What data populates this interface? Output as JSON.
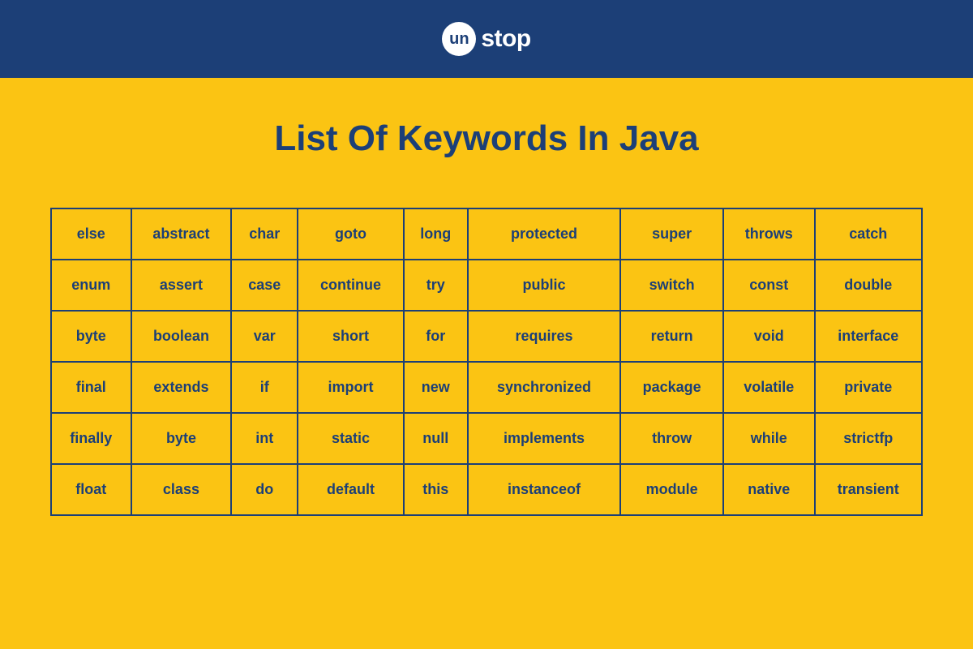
{
  "header": {
    "logo_prefix": "un",
    "logo_suffix": "stop"
  },
  "title": "List Of Keywords In Java",
  "table": {
    "rows": [
      [
        "else",
        "abstract",
        "char",
        "goto",
        "long",
        "protected",
        "super",
        "throws",
        "catch"
      ],
      [
        "enum",
        "assert",
        "case",
        "continue",
        "try",
        "public",
        "switch",
        "const",
        "double"
      ],
      [
        "byte",
        "boolean",
        "var",
        "short",
        "for",
        "requires",
        "return",
        "void",
        "interface"
      ],
      [
        "final",
        "extends",
        "if",
        "import",
        "new",
        "synchronized",
        "package",
        "volatile",
        "private"
      ],
      [
        "finally",
        "byte",
        "int",
        "static",
        "null",
        "implements",
        "throw",
        "while",
        "strictfp"
      ],
      [
        "float",
        "class",
        "do",
        "default",
        "this",
        "instanceof",
        "module",
        "native",
        "transient"
      ]
    ]
  }
}
